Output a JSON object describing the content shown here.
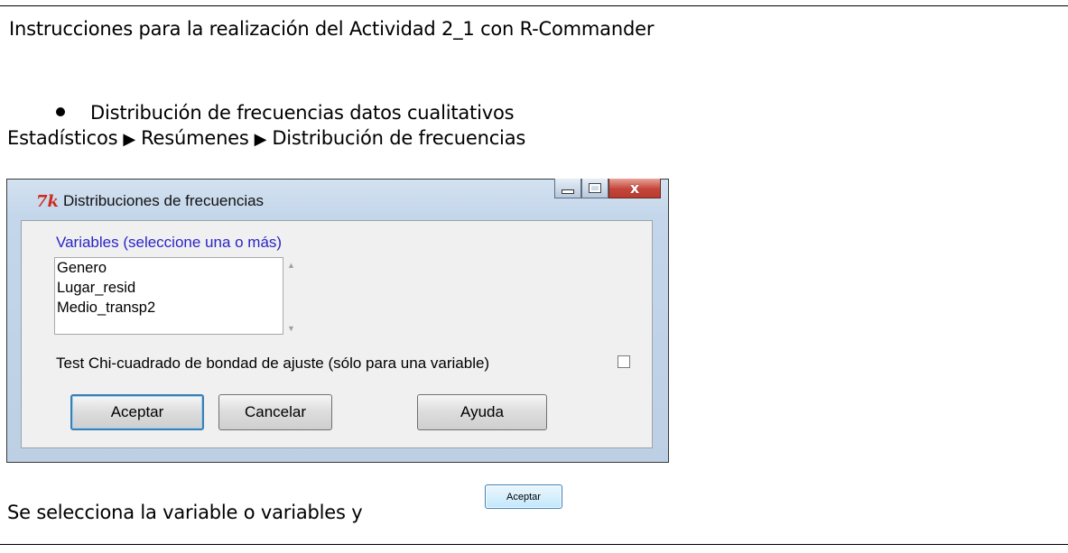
{
  "doc": {
    "heading": "Instrucciones para la realización del Actividad 2_1 con R-Commander",
    "bullet": "Distribución de frecuencias datos cualitativos",
    "menu_path": [
      "Estadísticos",
      "Resúmenes",
      "Distribución de frecuencias"
    ],
    "footer": "Se selecciona la variable o variables y",
    "inline_button": "Aceptar"
  },
  "dialog": {
    "title": "Distribuciones de frecuencias",
    "icon": "tk-icon",
    "variables_label": "Variables (seleccione una o más)",
    "variables": [
      "Genero",
      "Lugar_resid",
      "Medio_transp2"
    ],
    "chi_label": "Test Chi-cuadrado de bondad de ajuste (sólo para una variable)",
    "chi_checked": false,
    "buttons": {
      "ok": "Aceptar",
      "cancel": "Cancelar",
      "help": "Ayuda"
    }
  }
}
